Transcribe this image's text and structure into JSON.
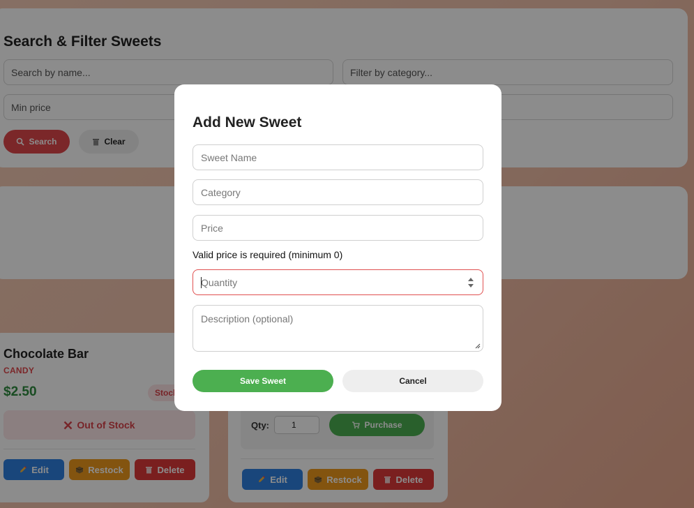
{
  "search_panel": {
    "title": "Search & Filter Sweets",
    "name_placeholder": "Search by name...",
    "category_placeholder": "Filter by category...",
    "min_price_placeholder": "Min price",
    "search_label": "Search",
    "clear_label": "Clear"
  },
  "cards": [
    {
      "name": "Chocolate Bar",
      "category": "CANDY",
      "price": "$2.50",
      "stock_badge": "Stock",
      "out_of_stock": "Out of Stock",
      "edit_label": "Edit",
      "restock_label": "Restock",
      "delete_label": "Delete"
    },
    {
      "qty_label": "Qty:",
      "qty_value": "1",
      "purchase_label": "Purchase",
      "edit_label": "Edit",
      "restock_label": "Restock",
      "delete_label": "Delete"
    }
  ],
  "modal": {
    "title": "Add New Sweet",
    "name_placeholder": "Sweet Name",
    "category_placeholder": "Category",
    "price_placeholder": "Price",
    "price_error": "Valid price is required (minimum 0)",
    "quantity_placeholder": "Quantity",
    "description_placeholder": "Description (optional)",
    "save_label": "Save Sweet",
    "cancel_label": "Cancel"
  },
  "colors": {
    "accent_red": "#e0474c",
    "success_green": "#4caf50",
    "edit_blue": "#2f80e0",
    "restock_orange": "#ef9a1c",
    "delete_red": "#de3a3a"
  },
  "icons": {
    "search": "magnifier-icon",
    "clear": "trash-icon",
    "out_of_stock": "x-icon",
    "edit": "pencil-icon",
    "restock": "box-icon",
    "delete": "trash-icon",
    "purchase": "cart-icon"
  }
}
